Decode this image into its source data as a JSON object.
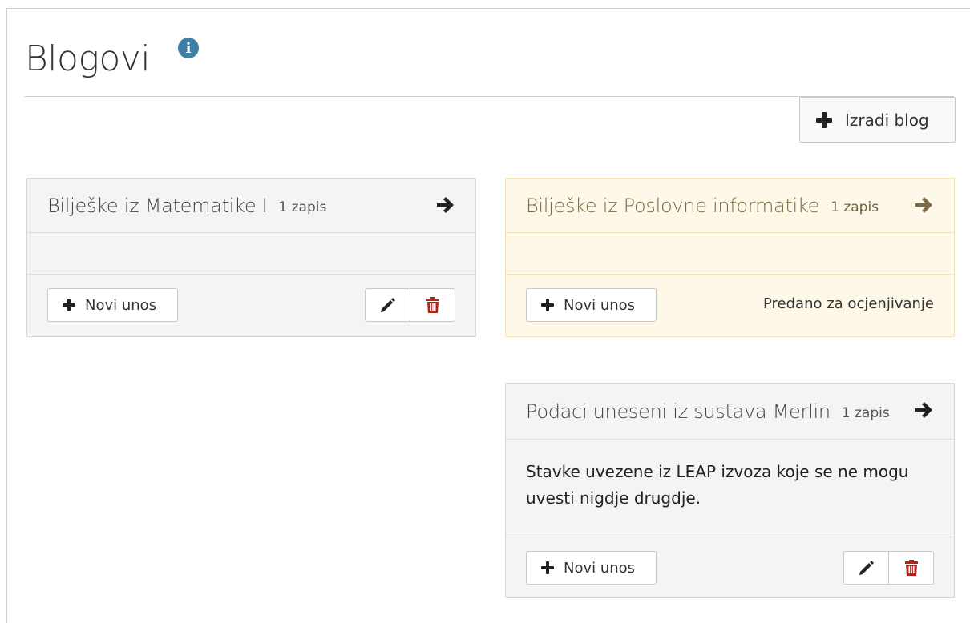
{
  "page": {
    "title": "Blogovi"
  },
  "toolbar": {
    "create_label": "Izradi blog"
  },
  "colors": {
    "accent_info": "#3f7ea5",
    "delete_red": "#b0261e",
    "submitted_bg": "#fdf8e7",
    "submitted_title": "#7a6a45"
  },
  "blogs": [
    {
      "title": "Bilješke iz Matematike I",
      "count": "1 zapis",
      "description": "",
      "new_entry_label": "Novi unos",
      "status": "",
      "icons": [
        "arrow-right-icon",
        "plus-icon",
        "pencil-icon",
        "trash-icon"
      ]
    },
    {
      "title": "Bilješke iz Poslovne informatike",
      "count": "1 zapis",
      "description": "",
      "new_entry_label": "Novi unos",
      "status": "Predano za ocjenjivanje",
      "icons": [
        "arrow-right-icon",
        "plus-icon"
      ]
    },
    {
      "title": "Podaci uneseni iz sustava Merlin",
      "count": "1 zapis",
      "description": "Stavke uvezene iz LEAP izvoza koje se ne mogu uvesti nigdje drugdje.",
      "new_entry_label": "Novi unos",
      "status": "",
      "icons": [
        "arrow-right-icon",
        "plus-icon",
        "pencil-icon",
        "trash-icon"
      ]
    }
  ]
}
